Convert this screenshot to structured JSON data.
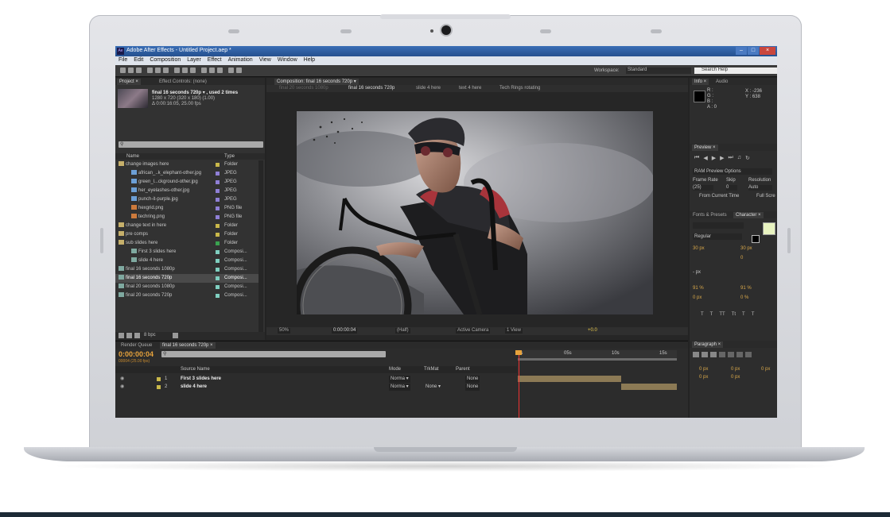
{
  "window": {
    "title": "Adobe After Effects - Untitled Project.aep *",
    "app_badge": "Ae"
  },
  "menu": [
    "File",
    "Edit",
    "Composition",
    "Layer",
    "Effect",
    "Animation",
    "View",
    "Window",
    "Help"
  ],
  "toolbar": {
    "workspace_label": "Workspace:",
    "workspace_value": "Standard",
    "search_placeholder": "Search Help"
  },
  "project": {
    "tabs": [
      "Project ×",
      "Effect Controls: (none)"
    ],
    "selected_name": "final 16 seconds 720p ▾ , used 2 times",
    "selected_dims": "1280 x 720  (320 x 180) (1.00)",
    "selected_dur": "Δ 0:00:16:05, 25.00 fps",
    "col_name": "Name",
    "col_type": "Type",
    "rows": [
      {
        "name": "change images here",
        "type": "Folder",
        "indent": 0,
        "kind": "folder",
        "label": "#c9b84a"
      },
      {
        "name": "african_..k_elephant-other.jpg",
        "type": "JPEG",
        "indent": 2,
        "kind": "image",
        "label": "#8f7fd6"
      },
      {
        "name": "green_l...ckground-other.jpg",
        "type": "JPEG",
        "indent": 2,
        "kind": "image",
        "label": "#8f7fd6"
      },
      {
        "name": "her_eyelashes-other.jpg",
        "type": "JPEG",
        "indent": 2,
        "kind": "image",
        "label": "#8f7fd6"
      },
      {
        "name": "punch-it-purple.jpg",
        "type": "JPEG",
        "indent": 2,
        "kind": "image",
        "label": "#8f7fd6"
      },
      {
        "name": "hexgrid.png",
        "type": "PNG file",
        "indent": 2,
        "kind": "png",
        "label": "#8f7fd6"
      },
      {
        "name": "techring.png",
        "type": "PNG file",
        "indent": 2,
        "kind": "png",
        "label": "#8f7fd6"
      },
      {
        "name": "change text in here",
        "type": "Folder",
        "indent": 0,
        "kind": "folder",
        "label": "#c9b84a"
      },
      {
        "name": "pre comps",
        "type": "Folder",
        "indent": 0,
        "kind": "folder",
        "label": "#c9b84a"
      },
      {
        "name": "sub slides here",
        "type": "Folder",
        "indent": 0,
        "kind": "folder",
        "label": "#3aa24f"
      },
      {
        "name": "First 3 slides here",
        "type": "Composi...",
        "indent": 2,
        "kind": "comp",
        "label": "#7fcfc0"
      },
      {
        "name": "slide 4 here",
        "type": "Composi...",
        "indent": 2,
        "kind": "comp",
        "label": "#7fcfc0"
      },
      {
        "name": "final 16 seconds 1080p",
        "type": "Composi...",
        "indent": 0,
        "kind": "comp",
        "label": "#7fcfc0"
      },
      {
        "name": "final 16 seconds 720p",
        "type": "Composi...",
        "indent": 0,
        "kind": "comp",
        "label": "#7fcfc0",
        "selected": true
      },
      {
        "name": "final 20 seconds 1080p",
        "type": "Composi...",
        "indent": 0,
        "kind": "comp",
        "label": "#7fcfc0"
      },
      {
        "name": "final 20 seconds 720p",
        "type": "Composi...",
        "indent": 0,
        "kind": "comp",
        "label": "#7fcfc0"
      }
    ],
    "footer_bpc": "8 bpc"
  },
  "composition": {
    "tab": "Composition: final 16 seconds 720p ▾",
    "subtabs": [
      "final 20 seconds 1080p",
      "final 16 seconds 720p",
      "slide 4 here",
      "text 4 here",
      "Tech Rings rotating"
    ],
    "zoom": "50%",
    "timecode": "0:00:00:04",
    "resolution": "(Half)",
    "camera": "Active Camera",
    "views": "1 View",
    "exposure": "+0.0"
  },
  "timeline": {
    "tabs": [
      "Render Queue",
      "final 16 seconds 720p ×"
    ],
    "timecode": "0:00:00:04",
    "fps_info": "00004 (25.00 fps)",
    "col_source": "Source Name",
    "col_mode": "Mode",
    "col_trkmat": "TrkMat",
    "col_parent": "Parent",
    "layers": [
      {
        "num": "1",
        "name": "First 3 slides here",
        "mode": "Norma ▾",
        "trkmat": "",
        "parent": "None"
      },
      {
        "num": "2",
        "name": "slide 4 here",
        "mode": "Norma ▾",
        "trkmat": "None ▾",
        "parent": "None"
      }
    ],
    "ruler": [
      "0s",
      "05s",
      "10s",
      "15s"
    ]
  },
  "info": {
    "tabs": [
      "Info ×",
      "Audio"
    ],
    "r": "R :",
    "g": "G :",
    "b": "B :",
    "a": "A : 0",
    "x": "X : -236",
    "y": "Y : 638"
  },
  "preview": {
    "tab": "Preview ×",
    "options": "RAM Preview Options",
    "frame_rate_label": "Frame Rate",
    "skip_label": "Skip",
    "resolution_label": "Resolution",
    "frame_rate": "(25)",
    "skip": "0",
    "resolution": "Auto",
    "from_current": "From Current Time",
    "full_screen": "Full Scre"
  },
  "character": {
    "tabs": [
      "Fonts & Presets",
      "Character ×"
    ],
    "style": "Regular",
    "size": "30 px",
    "leading": "30 px",
    "tracking": "0",
    "stroke": "- px",
    "vscale": "91 %",
    "hscale": "91 %",
    "baseline": "0 px",
    "tsume": "0 %",
    "styles": [
      "T",
      "T",
      "TT",
      "Tt",
      "T",
      "T"
    ]
  },
  "paragraph": {
    "tab": "Paragraph ×",
    "indent1": "0 px",
    "indent2": "0 px",
    "indent3": "0 px",
    "space1": "0 px",
    "space2": "0 px"
  },
  "colors": {
    "ae_dark": "#232323",
    "panel": "#323232",
    "timecode": "#e8a33c",
    "selection": "#4a4a4a",
    "titlebar": "#2f61a8"
  }
}
